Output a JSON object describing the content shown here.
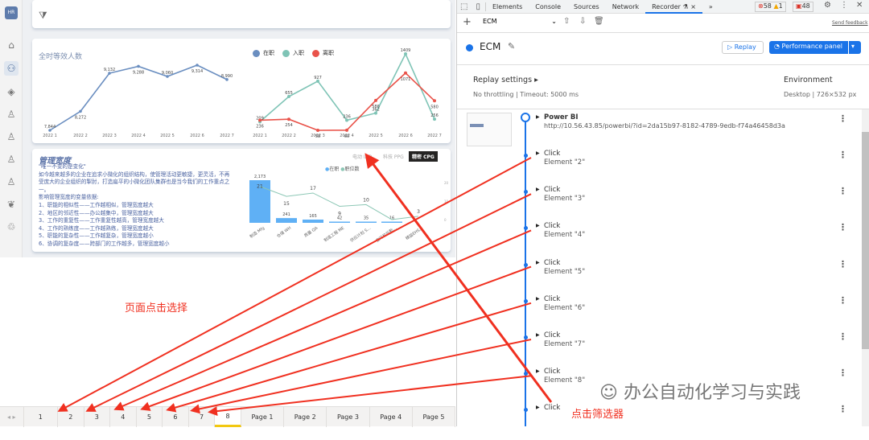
{
  "sidebar": {
    "avatar": "HR",
    "icons": [
      "home-icon",
      "people-icon",
      "layers-icon",
      "person-add-icon",
      "person-remove-icon",
      "person-edit-icon",
      "person-settings-icon",
      "leaf-icon",
      "recycle-icon"
    ],
    "selected": 1
  },
  "fte_chart": {
    "title": "全时等效人数"
  },
  "flow_chart": {
    "legend": [
      "在职",
      "入职",
      "离职"
    ]
  },
  "span": {
    "title": "管理宽度",
    "lines": [
      "\"唯一不变的是变化\"",
      "如今越来越多的企业在追求小微化的组织结构，使管理活动更敏捷，更灵活，不再受庞大的企业组织的掣肘，打造扁平的小微化团队集群也是当今我们的工作重点之一。",
      "影响管理宽度的变量依据:",
      "1、职能的相似性——工作越相似，管理宽度越大",
      "2、地区的邻近性——办公越集中，管理宽度越大",
      "3、工作的重复性——工作重复性越高，管理宽度越大",
      "4、工作的熟练度——工作越熟练，管理宽度越大",
      "5、职能的复杂性——工作越复杂，管理宽度越小",
      "6、协调的复杂度——跨部门的工作越多，管理宽度越小"
    ],
    "slicers": [
      "电动 IAD",
      "科技 PPG",
      "精密 CPG"
    ],
    "active_slicer": 2
  },
  "chart_data": [
    {
      "type": "line",
      "title": "全时等效人数",
      "categories": [
        "2022 1",
        "2022 2",
        "2022 3",
        "2022 4",
        "2022 5",
        "2022 6",
        "2022 7"
      ],
      "series": [
        {
          "name": "",
          "values": [
            7844,
            8272,
            9132,
            9288,
            9060,
            9314,
            8990
          ],
          "labels": [
            "7,844",
            "8,272",
            "9,132",
            "9,288",
            "9,060",
            "9,314",
            "8,990"
          ]
        }
      ],
      "color": "#6a8ec0",
      "ylim": [
        7844,
        9314
      ]
    },
    {
      "type": "line",
      "categories": [
        "2022 1",
        "2022 2",
        "2022 3",
        "2022 4",
        "2022 5",
        "2022 6",
        "2022 7"
      ],
      "legend": "top",
      "series": [
        {
          "name": "入职",
          "color": "#7fc4b6",
          "values": [
            209,
            655,
            927,
            236,
            362,
            1409,
            256
          ]
        },
        {
          "name": "离职",
          "color": "#e9534a",
          "values": [
            236,
            254,
            58,
            60,
            586,
            1071,
            580
          ]
        }
      ],
      "ylim": [
        58,
        1409
      ]
    },
    {
      "type": "bar+line",
      "legend": [
        "在职",
        "职位数"
      ],
      "categories": [
        "制造 Mfg",
        "仓储 WH",
        "质量 QA",
        "制造工程 ME",
        "供应计划 S...",
        "安环和后勤...",
        "精益EHS..."
      ],
      "series": [
        {
          "name": "在职",
          "color": "#5fb0f5",
          "values": [
            2173,
            241,
            165,
            42,
            35,
            16,
            null
          ],
          "labels": [
            "2,173",
            "241",
            "165",
            "42",
            "35",
            "16",
            ""
          ]
        },
        {
          "name": "职位数",
          "color": "#8cc7b5",
          "values": [
            21,
            15,
            17,
            9,
            10,
            1,
            3
          ],
          "labels": [
            "21",
            "15",
            "17",
            "9",
            "10",
            "",
            "3"
          ]
        }
      ],
      "right_axis": [
        "20",
        "10",
        "0"
      ]
    }
  ],
  "tabs": {
    "items": [
      "1",
      "2",
      "3",
      "4",
      "5",
      "6",
      "7",
      "8",
      "Page 1",
      "Page 2",
      "Page 3",
      "Page 4",
      "Page 5"
    ],
    "active": 7
  },
  "annotations": {
    "left": "页面点击选择",
    "right": "点击筛选器",
    "watermark": "办公自动化学习与实践"
  },
  "devtools": {
    "tabs": [
      "Elements",
      "Console",
      "Sources",
      "Network",
      "Recorder ⚗ ×",
      "»"
    ],
    "errors": "58",
    "warnings": "1",
    "issues": "48",
    "recording_select": "ECM",
    "send_feedback": "Send feedback",
    "recording_title": "ECM",
    "replay": "▷ Replay",
    "performance": "Performance panel",
    "replay_settings": "Replay settings",
    "throttling": "No throttling",
    "timeout": "Timeout: 5000 ms",
    "environment": "Environment",
    "device": "Desktop",
    "viewport": "726×532 px",
    "first_step": {
      "title": "Power BI",
      "url": "http://10.56.43.85/powerbi/?id=2da15b97-8182-4789-9edb-f74a46458d3a"
    },
    "steps": [
      {
        "title": "Click",
        "sub": "Element \"2\""
      },
      {
        "title": "Click",
        "sub": "Element \"3\""
      },
      {
        "title": "Click",
        "sub": "Element \"4\""
      },
      {
        "title": "Click",
        "sub": "Element \"5\""
      },
      {
        "title": "Click",
        "sub": "Element \"6\""
      },
      {
        "title": "Click",
        "sub": "Element \"7\""
      },
      {
        "title": "Click",
        "sub": "Element \"8\""
      },
      {
        "title": "Click",
        "sub": ""
      }
    ]
  },
  "colors": {
    "accent": "#1a73e8",
    "annotation": "#f03020",
    "active_tab": "#f2c811"
  }
}
